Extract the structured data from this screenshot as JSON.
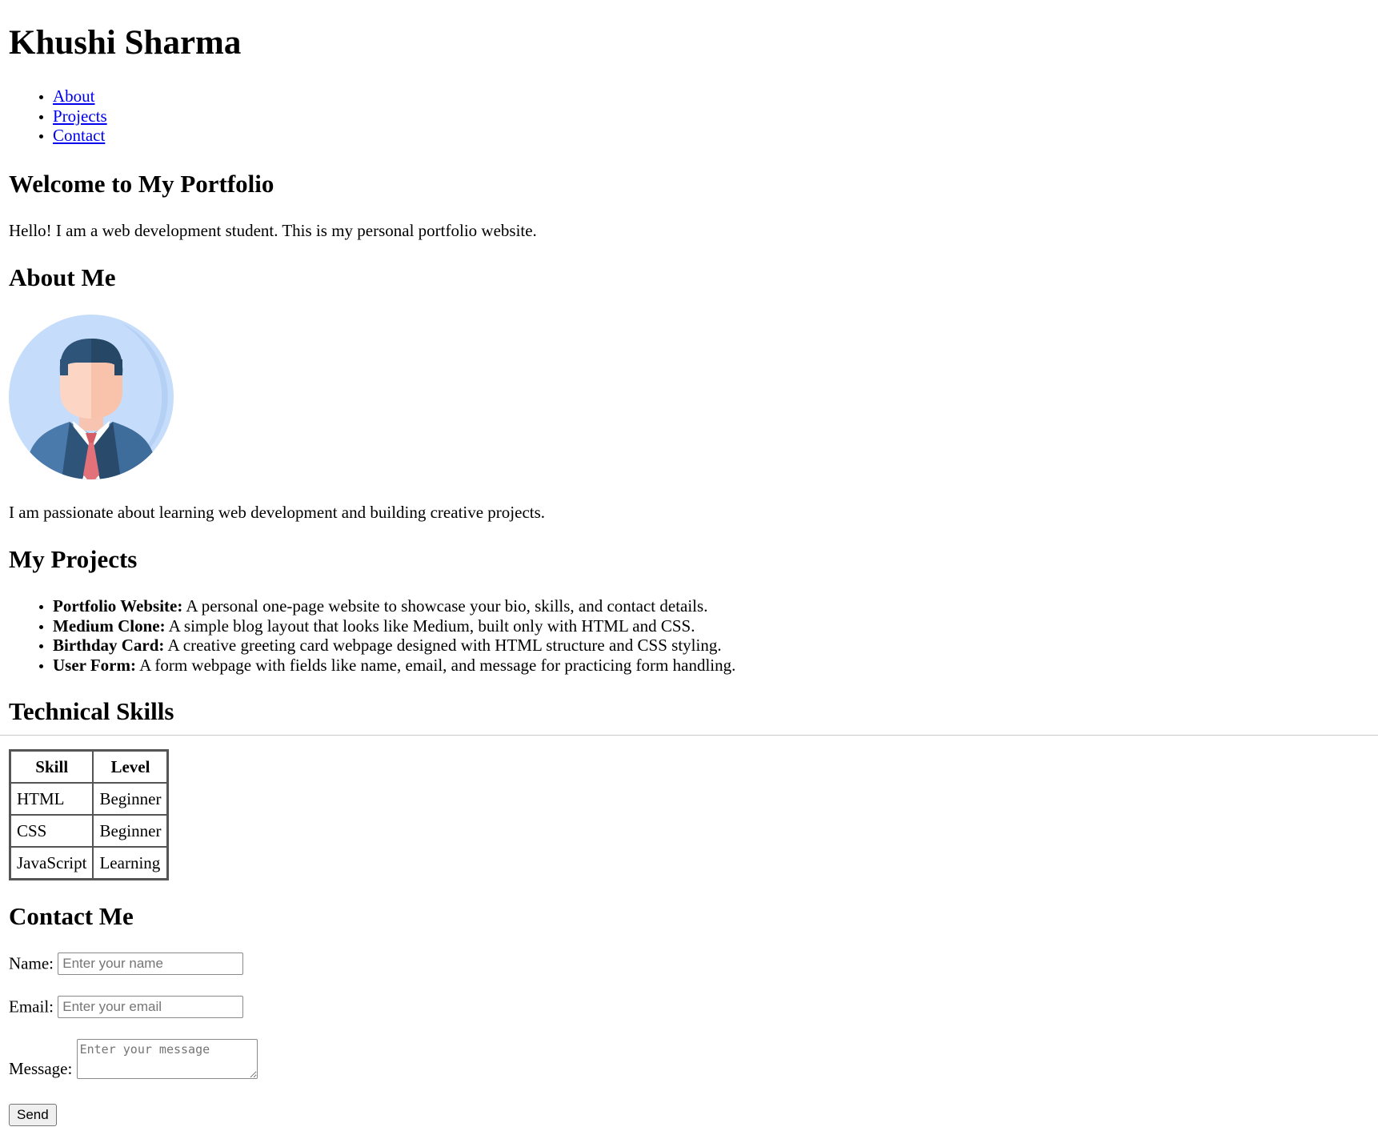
{
  "header": {
    "name": "Khushi Sharma",
    "nav": [
      {
        "label": "About"
      },
      {
        "label": "Projects"
      },
      {
        "label": "Contact"
      }
    ]
  },
  "welcome": {
    "heading": "Welcome to My Portfolio",
    "text": "Hello! I am a web development student. This is my personal portfolio website."
  },
  "about": {
    "heading": "About Me",
    "avatar_icon": "businessman-avatar-icon",
    "text": "I am passionate about learning web development and building creative projects."
  },
  "projects": {
    "heading": "My Projects",
    "items": [
      {
        "title": "Portfolio Website:",
        "desc": " A personal one-page website to showcase your bio, skills, and contact details."
      },
      {
        "title": "Medium Clone:",
        "desc": " A simple blog layout that looks like Medium, built only with HTML and CSS."
      },
      {
        "title": "Birthday Card:",
        "desc": " A creative greeting card webpage designed with HTML structure and CSS styling."
      },
      {
        "title": "User Form:",
        "desc": " A form webpage with fields like name, email, and message for practicing form handling."
      }
    ]
  },
  "skills": {
    "heading": "Technical Skills",
    "columns": [
      "Skill",
      "Level"
    ],
    "rows": [
      [
        "HTML",
        "Beginner"
      ],
      [
        "CSS",
        "Beginner"
      ],
      [
        "JavaScript",
        "Learning"
      ]
    ]
  },
  "contact": {
    "heading": "Contact Me",
    "name_label": "Name:",
    "name_placeholder": "Enter your name",
    "email_label": "Email:",
    "email_placeholder": "Enter your email",
    "message_label": "Message:",
    "message_placeholder": "Enter your message",
    "send_label": "Send"
  }
}
